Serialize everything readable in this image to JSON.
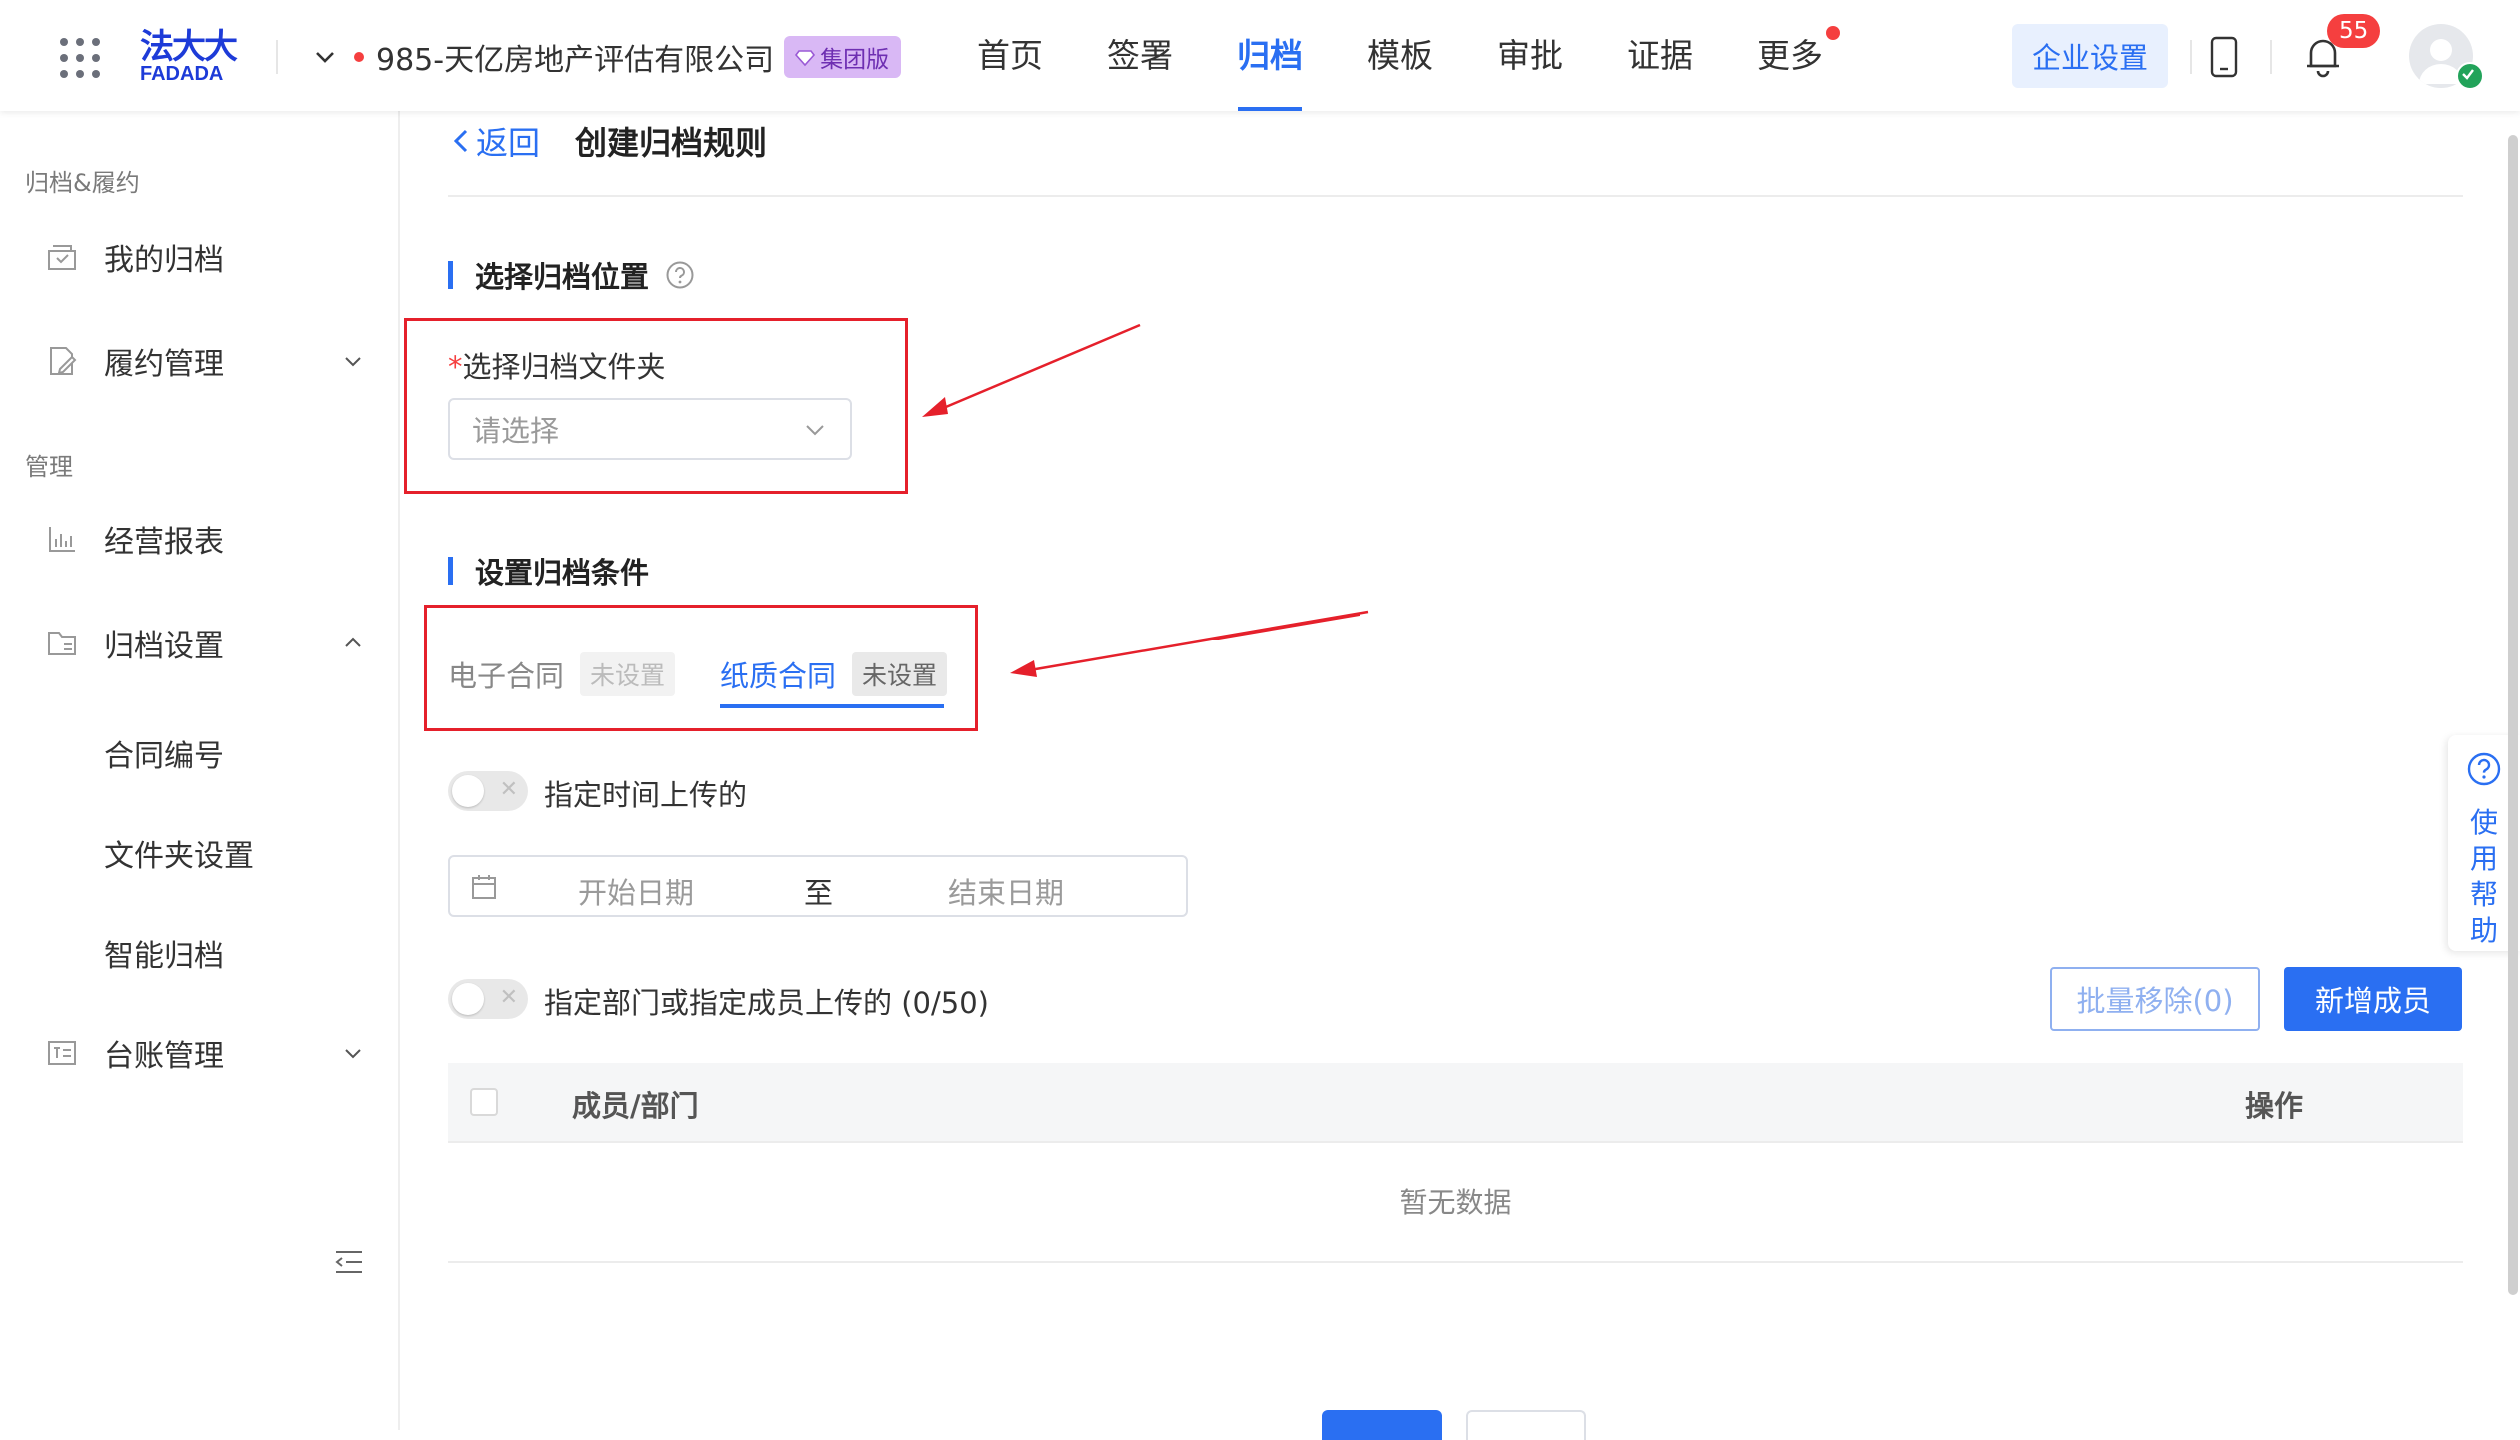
{
  "brand": {
    "logo_cn": "法大大",
    "logo_en": "FADADA"
  },
  "company": {
    "name": "985-天亿房地产评估有限公司",
    "badge": "集团版"
  },
  "nav": {
    "items": [
      {
        "label": "首页"
      },
      {
        "label": "签署"
      },
      {
        "label": "归档",
        "active": true
      },
      {
        "label": "模板"
      },
      {
        "label": "审批"
      },
      {
        "label": "证据"
      },
      {
        "label": "更多",
        "has_dot": true
      }
    ]
  },
  "header": {
    "enterprise_settings": "企业设置",
    "notification_count": "55"
  },
  "sidebar": {
    "group1": "归档&履约",
    "my_archive": "我的归档",
    "fulfillment": "履约管理",
    "group2": "管理",
    "reports": "经营报表",
    "archive_settings": "归档设置",
    "sub_contract_no": "合同编号",
    "sub_folder_settings": "文件夹设置",
    "sub_smart_archive": "智能归档",
    "ledger": "台账管理"
  },
  "page": {
    "back": "返回",
    "title": "创建归档规则"
  },
  "section1": {
    "title": "选择归档位置",
    "field_label": "选择归档文件夹",
    "required_mark": "*",
    "select_placeholder": "请选择"
  },
  "section2": {
    "title": "设置归档条件",
    "tabs": [
      {
        "label": "电子合同",
        "tag": "未设置"
      },
      {
        "label": "纸质合同",
        "tag": "未设置",
        "active": true
      }
    ],
    "toggle_time_label": "指定时间上传的",
    "date_start": "开始日期",
    "date_sep": "至",
    "date_end": "结束日期",
    "toggle_member_label": "指定部门或指定成员上传的 (0/50)",
    "batch_remove": "批量移除(0)",
    "add_member": "新增成员",
    "table": {
      "col_member": "成员/部门",
      "col_action": "操作",
      "empty": "暂无数据"
    }
  },
  "help_float": {
    "label": "使用帮助"
  },
  "colors": {
    "accent": "#2a6ff2",
    "highlight_box": "#e5202b",
    "badge_bg": "#d9b8f5",
    "danger": "#f53f3f"
  }
}
